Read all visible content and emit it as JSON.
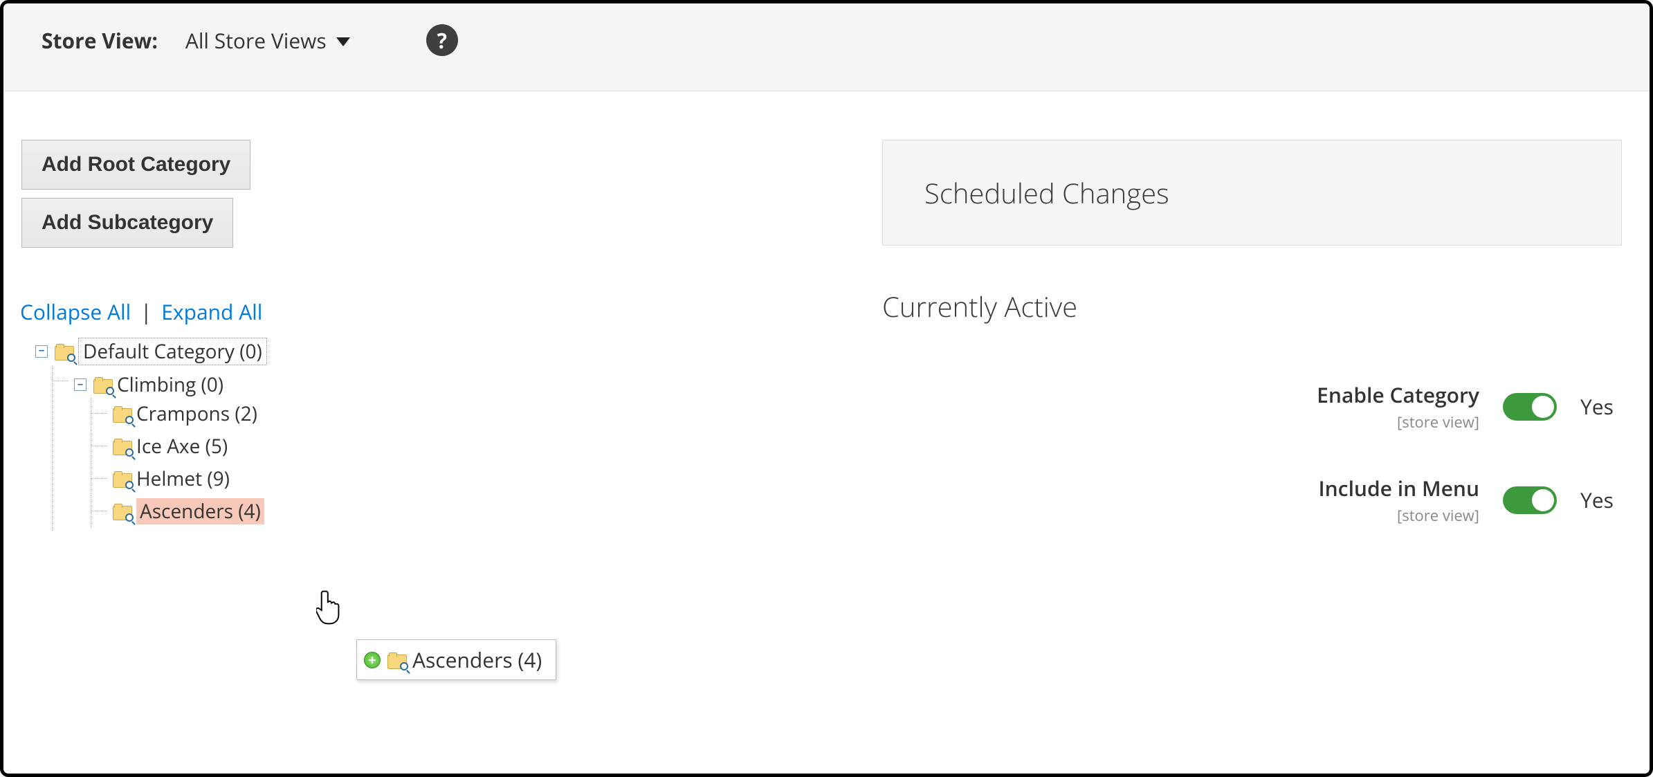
{
  "topbar": {
    "store_view_label": "Store View:",
    "store_view_value": "All Store Views",
    "help_glyph": "?"
  },
  "left": {
    "add_root_label": "Add Root Category",
    "add_sub_label": "Add Subcategory",
    "collapse_label": "Collapse All",
    "expand_label": "Expand All",
    "separator": " | ",
    "tree": {
      "root": {
        "label": "Default Category (0)",
        "toggle": "−"
      },
      "climbing": {
        "label": "Climbing (0)",
        "toggle": "−"
      },
      "children": [
        {
          "label": "Crampons (2)"
        },
        {
          "label": "Ice Axe (5)"
        },
        {
          "label": "Helmet (9)"
        },
        {
          "label": "Ascenders (4)"
        }
      ]
    },
    "drag_ghost": {
      "plus": "+",
      "label": "Ascenders (4)"
    }
  },
  "right": {
    "panel_title": "Scheduled Changes",
    "section_title": "Currently Active",
    "fields": {
      "enable": {
        "label": "Enable Category",
        "scope": "[store view]",
        "value": "Yes"
      },
      "include": {
        "label": "Include in Menu",
        "scope": "[store view]",
        "value": "Yes"
      }
    }
  }
}
